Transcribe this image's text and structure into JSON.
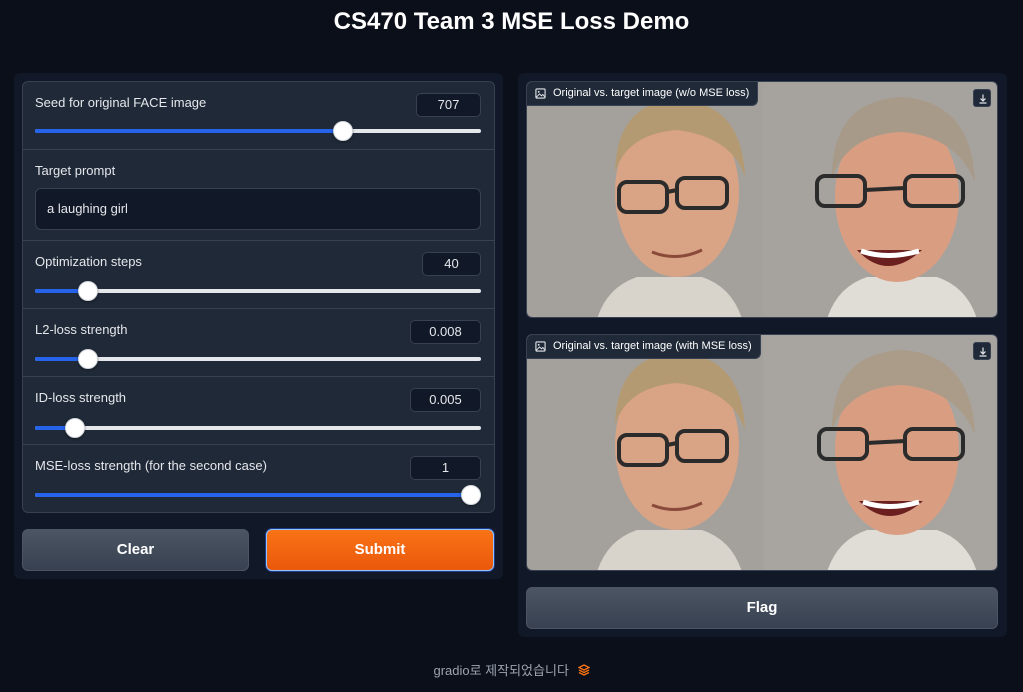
{
  "page": {
    "title": "CS470 Team 3 MSE Loss Demo"
  },
  "inputs": {
    "seed": {
      "label": "Seed for original FACE image",
      "value": "707",
      "fraction": 0.7
    },
    "prompt": {
      "label": "Target prompt",
      "value": "a laughing girl"
    },
    "steps": {
      "label": "Optimization steps",
      "value": "40",
      "fraction": 0.1
    },
    "l2": {
      "label": "L2-loss strength",
      "value": "0.008",
      "fraction": 0.1
    },
    "id": {
      "label": "ID-loss strength",
      "value": "0.005",
      "fraction": 0.07
    },
    "mse": {
      "label": "MSE-loss strength (for the second case)",
      "value": "1",
      "fraction": 1.0
    }
  },
  "buttons": {
    "clear": "Clear",
    "submit": "Submit",
    "flag": "Flag"
  },
  "outputs": {
    "image1": {
      "label": "Original vs. target image (w/o MSE loss)",
      "icon": "image-icon",
      "action_icon": "download-icon"
    },
    "image2": {
      "label": "Original vs. target image (with MSE loss)",
      "icon": "image-icon",
      "action_icon": "download-icon"
    }
  },
  "footer": {
    "text": "gradio로 제작되었습니다",
    "logo_icon": "gradio-logo-icon"
  },
  "colors": {
    "accent": "#2563eb",
    "submit": "#f97316",
    "background": "#0b0f19"
  }
}
